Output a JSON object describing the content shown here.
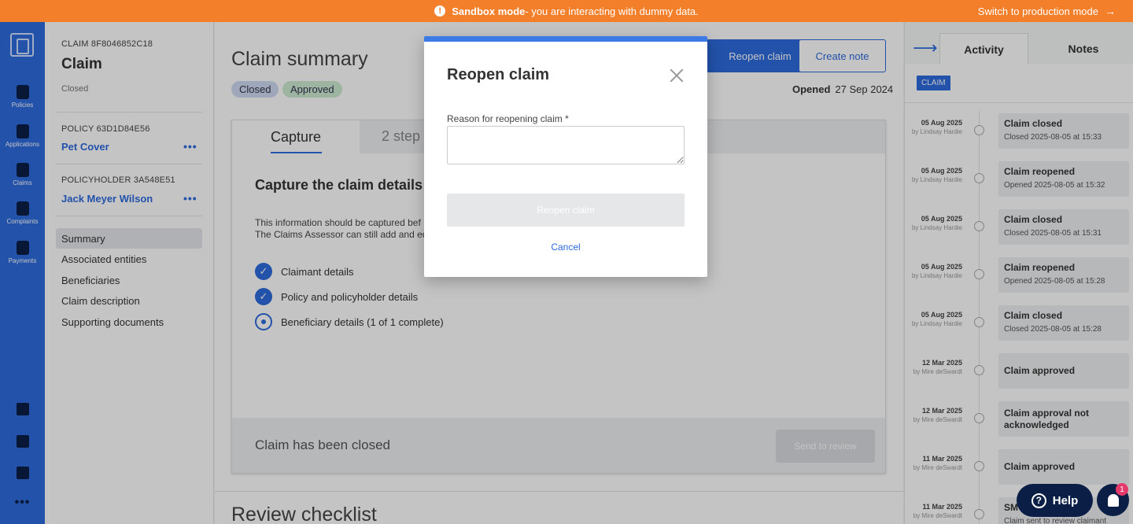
{
  "banner": {
    "mode": "Sandbox mode",
    "message": " - you are interacting with dummy data.",
    "switch_label": "Switch to production mode"
  },
  "rail": {
    "items": [
      {
        "label": "Policies",
        "icon": "policies-icon"
      },
      {
        "label": "Applications",
        "icon": "applications-icon"
      },
      {
        "label": "Claims",
        "icon": "claims-icon"
      },
      {
        "label": "Complaints",
        "icon": "complaints-icon"
      },
      {
        "label": "Payments",
        "icon": "payments-icon"
      }
    ]
  },
  "sidebar": {
    "claim_id": "CLAIM 8F8046852C18",
    "claim_title": "Claim",
    "status": "Closed",
    "policy_id": "POLICY 63D1D84E56",
    "policy_name": "Pet Cover",
    "policyholder_id": "POLICYHOLDER 3A548E51",
    "policyholder_name": "Jack Meyer Wilson",
    "nav": [
      {
        "label": "Summary",
        "active": true
      },
      {
        "label": "Associated entities",
        "active": false
      },
      {
        "label": "Beneficiaries",
        "active": false
      },
      {
        "label": "Claim description",
        "active": false
      },
      {
        "label": "Supporting documents",
        "active": false
      }
    ]
  },
  "main": {
    "title": "Claim summary",
    "badges": [
      "Closed",
      "Approved"
    ],
    "reopen_button": "Reopen claim",
    "create_note_button": "Create note",
    "opened_label": "Opened",
    "opened_date": "27 Sep 2024",
    "tabs": [
      "Capture",
      "2 step"
    ],
    "section_title": "Capture the claim details",
    "info_line1": "This information should be captured bef",
    "info_line2": "The Claims Assessor can still add and ed",
    "checklist": [
      {
        "label": "Claimant details",
        "state": "complete"
      },
      {
        "label": "Policy and policyholder details",
        "state": "complete"
      },
      {
        "label": "Beneficiary details (1 of 1 complete)",
        "state": "in-progress"
      }
    ],
    "footer_text": "Claim has been closed",
    "send_button": "Send to review",
    "review_title": "Review checklist"
  },
  "panel": {
    "tabs": [
      "Activity",
      "Notes"
    ],
    "chip": "CLAIM",
    "entries": [
      {
        "date": "05 Aug 2025",
        "by": "by Lindsay Hardie",
        "title": "Claim closed",
        "sub": "Closed 2025-08-05 at 15:33"
      },
      {
        "date": "05 Aug 2025",
        "by": "by Lindsay Hardie",
        "title": "Claim reopened",
        "sub": "Opened 2025-08-05 at 15:32"
      },
      {
        "date": "05 Aug 2025",
        "by": "by Lindsay Hardie",
        "title": "Claim closed",
        "sub": "Closed 2025-08-05 at 15:31"
      },
      {
        "date": "05 Aug 2025",
        "by": "by Lindsay Hardie",
        "title": "Claim reopened",
        "sub": "Opened 2025-08-05 at 15:28"
      },
      {
        "date": "05 Aug 2025",
        "by": "by Lindsay Hardie",
        "title": "Claim closed",
        "sub": "Closed 2025-08-05 at 15:28"
      },
      {
        "date": "12 Mar 2025",
        "by": "by Mire deSwardt",
        "title": "Claim approved",
        "sub": ""
      },
      {
        "date": "12 Mar 2025",
        "by": "by Mire deSwardt",
        "title": "Claim approval not acknowledged",
        "sub": ""
      },
      {
        "date": "11 Mar 2025",
        "by": "by Mire deSwardt",
        "title": "Claim approved",
        "sub": ""
      },
      {
        "date": "11 Mar 2025",
        "by": "by Mire deSwardt",
        "title": "SM",
        "sub": "Claim sent to review claimant"
      }
    ]
  },
  "modal": {
    "title": "Reopen claim",
    "field_label": "Reason for reopening claim *",
    "field_value": "",
    "submit_label": "Reopen claim",
    "cancel_label": "Cancel"
  },
  "help": {
    "label": "Help"
  },
  "notifications": {
    "count": "1"
  }
}
